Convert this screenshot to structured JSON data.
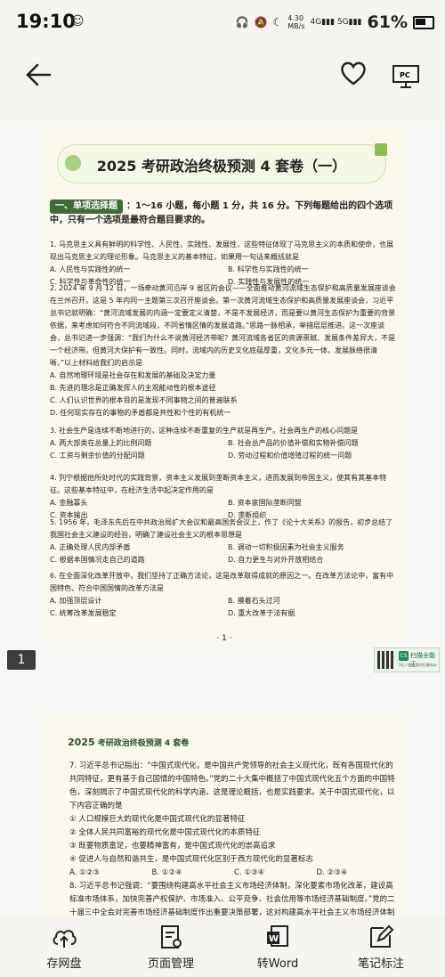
{
  "status": {
    "time": "19:10",
    "net_speed": "4.30\nMB/s",
    "battery": "61%"
  },
  "page1": {
    "title": "2025 考研政治终极预测 4 套卷（一）",
    "section_tag": "一、单项选择题",
    "section_rest": "：1～16 小题，每小题 1 分，共 16 分。下列每题给出的四个选项中，只有一个选项是最符合题目要求的。",
    "questions": [
      {
        "stem": "1. 马克思主义具有鲜明的科学性、人民性、实践性、发展性，这些特征体现了马克思主义的本质和使命，也展现出马克思主义的理论形象。马克思主义的基本特征，如果用一句话来概括就是",
        "options": [
          "A. 人民性与实践性的统一",
          "B. 科学性与实践性的统一",
          "C. 科学性与革命性的统一",
          "D. 实践性与发展性的统一"
        ]
      },
      {
        "stem": "2. 2024 年 9 月 12 日，一场牵动黄河沿岸 9 省区的会议——全面推动黄河流域生态保护和高质量发展座谈会在兰州召开。这是 5 年内同一主题第三次召开座谈会。第一次黄河流域生态保护和高质量发展座谈会，习近平总书记就明确：“黄河流域发展的内涵一定要定义清楚，不是不发展经济，而是要以黄河生态保护为重要的背景依据，来考虑如何符合不同流域段，不同省情区情的发展道路。”思路一脉相承，举措层层推进。这一次座谈会，总书记进一步强调：“我们为什么不说黄河经济带呢？黄河流域各省区的资源禀赋、发展条件差异大，不是一个经济带。但黄河大保护有一致性。同时，流域内的历史文化底蕴厚重，文化多元一体，发展脉络很清晰。”以上材料给我们的启示是",
        "options": [
          "A. 自然地理环境是社会存在和发展的基础及决定力量",
          "B. 先进的理念是正确发挥人的主观能动性的根本途径",
          "C. 人们认识世界的根本目的是发现不同事物之间的普遍联系",
          "D. 任何现实存在的事物的矛盾都是共性和个性的有机统一"
        ],
        "single_col": true
      },
      {
        "stem": "3. 社会生产是连续不断地进行的，这种连续不断重复的生产就是再生产。社会再生产的核心问题是",
        "options": [
          "A. 两大部类在总量上的比例问题",
          "B. 社会总产品的价值补偿和实物补偿问题",
          "C. 工资与剩余价值的分配问题",
          "D. 劳动过程和价值增殖过程的统一问题"
        ]
      },
      {
        "stem": "4. 列宁根据他所处时代的实践背景，资本主义发展到垄断资本主义，进而发展到帝国主义，使其有其基本特征。这些基本特征中，在经济生活中起决定作用的是",
        "options": [
          "A. 金融寡头",
          "B. 资本家国际垄断同盟",
          "C. 资本输出",
          "D. 垄断组织"
        ]
      },
      {
        "stem": "5. 1956 年，毛泽东先后在中共政治局扩大会议和最高国务会议上，作了《论十大关系》的报告，初步总结了我国社会主义建设的经验，明确了建设社会主义的根本思想是",
        "options": [
          "A. 正确处理人民内部矛盾",
          "B. 调动一切积极因素为社会主义服务",
          "C. 根据本国情况走自己的道路",
          "D. 自力更生与对外开放相结合"
        ]
      },
      {
        "stem": "6. 在全面深化改革开放中，我们坚持了正确方法论，这是改革取得成就的原因之一。在改革方法论中，富有中国特色、符合中国国情的改革方法是",
        "options": [
          "A. 加强顶层设计",
          "B. 摸着石头过河",
          "C. 统筹改革发展稳定",
          "D. 重大改革于法有据"
        ]
      }
    ],
    "page_number": "· 1 ·"
  },
  "page_badge": "1",
  "qr": {
    "label": "扫描全能王",
    "sub": "3亿人都在用的扫描App",
    "cs": "CS"
  },
  "page2": {
    "header_year": "2025",
    "header_rest": " 考研政治终极预测 4 套卷",
    "q7_stem": "7. 习近平总书记指出：“中国式现代化，是中国共产党领导的社会主义现代化，既有各国现代化的共同特征，更有基于自己国情的中国特色。”党的二十大集中概括了中国式现代化五个方面的中国特色，深刻揭示了中国式现代化的科学内涵，这是理论概括，也是实践要求。关于中国式现代化，以下内容正确的是",
    "q7_items": [
      "① 人口规模巨大的现代化是中国式现代化的显著特征",
      "② 全体人民共同富裕的现代化是中国式现代化的本质特征",
      "③ 既要物质富足，也要精神富有，是中国式现代化的崇高追求",
      "④ 促进人与自然和谐共生，是中国式现代化区别于西方现代化的显著标志"
    ],
    "q7_options": [
      "A. ①②③",
      "B. ①②④",
      "C. ①③④",
      "D. ②③④"
    ],
    "q8_stem": "8. 习近平总书记强调：“要围绕构建高水平社会主义市场经济体制，深化要素市场化改革，建设高标准市场体系，加快完善产权保护、市场准入、公平竞争、社会信用等市场经济基础制度。”党的二十届三中全会对完善市场经济基础制度作出重要决策部署，这对构建高水平社会主义市场经济体制"
  },
  "bottom_nav": [
    {
      "label": "存网盘",
      "icon": "cloud-upload-icon"
    },
    {
      "label": "页面管理",
      "icon": "page-manage-icon"
    },
    {
      "label": "转Word",
      "icon": "word-convert-icon"
    },
    {
      "label": "笔记标注",
      "icon": "note-edit-icon"
    }
  ]
}
